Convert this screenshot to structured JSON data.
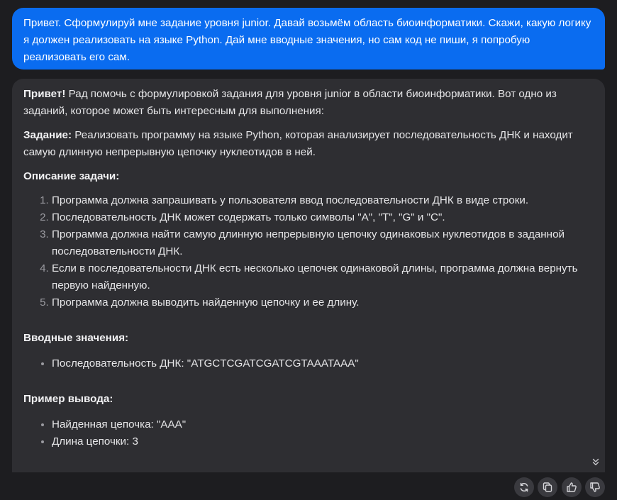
{
  "user_message": {
    "text": "Привет. Сформулируй мне задание уровня junior. Давай возьмём область биоинформатики. Скажи, какую логику я должен реализовать на языке Python. Дай мне вводные значения, но сам код не пиши, я попробую реализовать его сам."
  },
  "assistant_message": {
    "greeting_bold": "Привет!",
    "greeting_rest": " Рад помочь с формулировкой задания для уровня junior в области биоинформатики. Вот одно из заданий, которое может быть интересным для выполнения:",
    "task_label": "Задание:",
    "task_text": " Реализовать программу на языке Python, которая анализирует последовательность ДНК и находит самую длинную непрерывную цепочку нуклеотидов в ней.",
    "description_heading": "Описание задачи:",
    "description_items": [
      "Программа должна запрашивать у пользователя ввод последовательности ДНК в виде строки.",
      "Последовательность ДНК может содержать только символы \"A\", \"T\", \"G\" и \"C\".",
      "Программа должна найти самую длинную непрерывную цепочку одинаковых нуклеотидов в заданной последовательности ДНК.",
      "Если в последовательности ДНК есть несколько цепочек одинаковой длины, программа должна вернуть первую найденную.",
      "Программа должна выводить найденную цепочку и ее длину."
    ],
    "input_heading": "Вводные значения:",
    "input_items": [
      "Последовательность ДНК: \"ATGCTCGATCGATCGTAAATAAA\""
    ],
    "output_heading": "Пример вывода:",
    "output_items": [
      "Найденная цепочка: \"AAA\"",
      "Длина цепочки: 3"
    ]
  },
  "icons": {
    "scroll_down": "chevron-double-down-icon",
    "regenerate": "refresh-icon",
    "copy": "copy-icon",
    "like": "thumbs-up-icon",
    "dislike": "thumbs-down-icon"
  },
  "colors": {
    "user_bubble": "#0a6cf0",
    "assistant_bubble": "#2e2e32",
    "background": "#1d1d20"
  }
}
